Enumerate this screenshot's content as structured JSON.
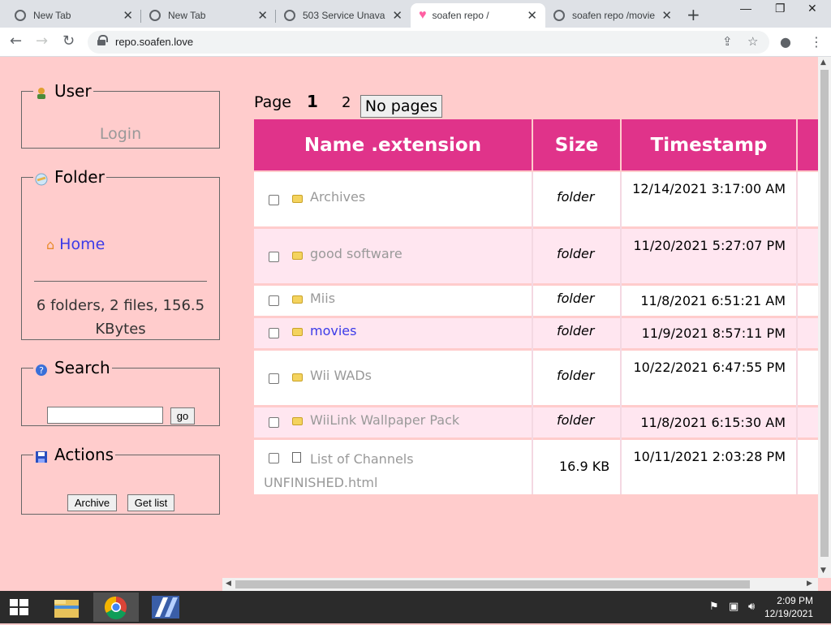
{
  "browser": {
    "tabs": [
      {
        "title": "New Tab",
        "active": false
      },
      {
        "title": "New Tab",
        "active": false
      },
      {
        "title": "503 Service Unava",
        "active": false
      },
      {
        "title": "soafen repo /",
        "active": true
      },
      {
        "title": "soafen repo /movie",
        "active": false
      }
    ],
    "url": "repo.soafen.love"
  },
  "sidebar": {
    "user": {
      "legend": "User",
      "login": "Login"
    },
    "folder": {
      "legend": "Folder",
      "home": "Home",
      "stats": "6 folders, 2 files, 156.5 KBytes"
    },
    "search": {
      "legend": "Search",
      "button": "go"
    },
    "actions": {
      "legend": "Actions",
      "archive": "Archive",
      "get_list": "Get list"
    }
  },
  "pager": {
    "label": "Page",
    "current": "1",
    "next": "2",
    "button": "No pages"
  },
  "table": {
    "columns": [
      "Name .extension",
      "Size",
      "Timestamp"
    ],
    "rows": [
      {
        "name": "Archives",
        "size": "folder",
        "timestamp": "12/14/2021 3:17:00 AM",
        "type": "folder"
      },
      {
        "name": "good software",
        "size": "folder",
        "timestamp": "11/20/2021 5:27:07 PM",
        "type": "folder"
      },
      {
        "name": "Miis",
        "size": "folder",
        "timestamp": "11/8/2021 6:51:21 AM",
        "type": "folder"
      },
      {
        "name": "movies",
        "size": "folder",
        "timestamp": "11/9/2021 8:57:11 PM",
        "type": "folder"
      },
      {
        "name": "Wii WADs",
        "size": "folder",
        "timestamp": "10/22/2021 6:47:55 PM",
        "type": "folder"
      },
      {
        "name": "WiiLink Wallpaper Pack",
        "size": "folder",
        "timestamp": "11/8/2021 6:15:30 AM",
        "type": "folder"
      },
      {
        "name": "List of Channels UNFINISHED.html",
        "size": "16.9 KB",
        "timestamp": "10/11/2021 2:03:28 PM",
        "type": "file"
      }
    ]
  },
  "taskbar": {
    "time": "2:09 PM",
    "date": "12/19/2021"
  },
  "colors": {
    "page_bg": "#ffcccc",
    "header_bg": "#e0338a",
    "link": "#3b3be8"
  }
}
